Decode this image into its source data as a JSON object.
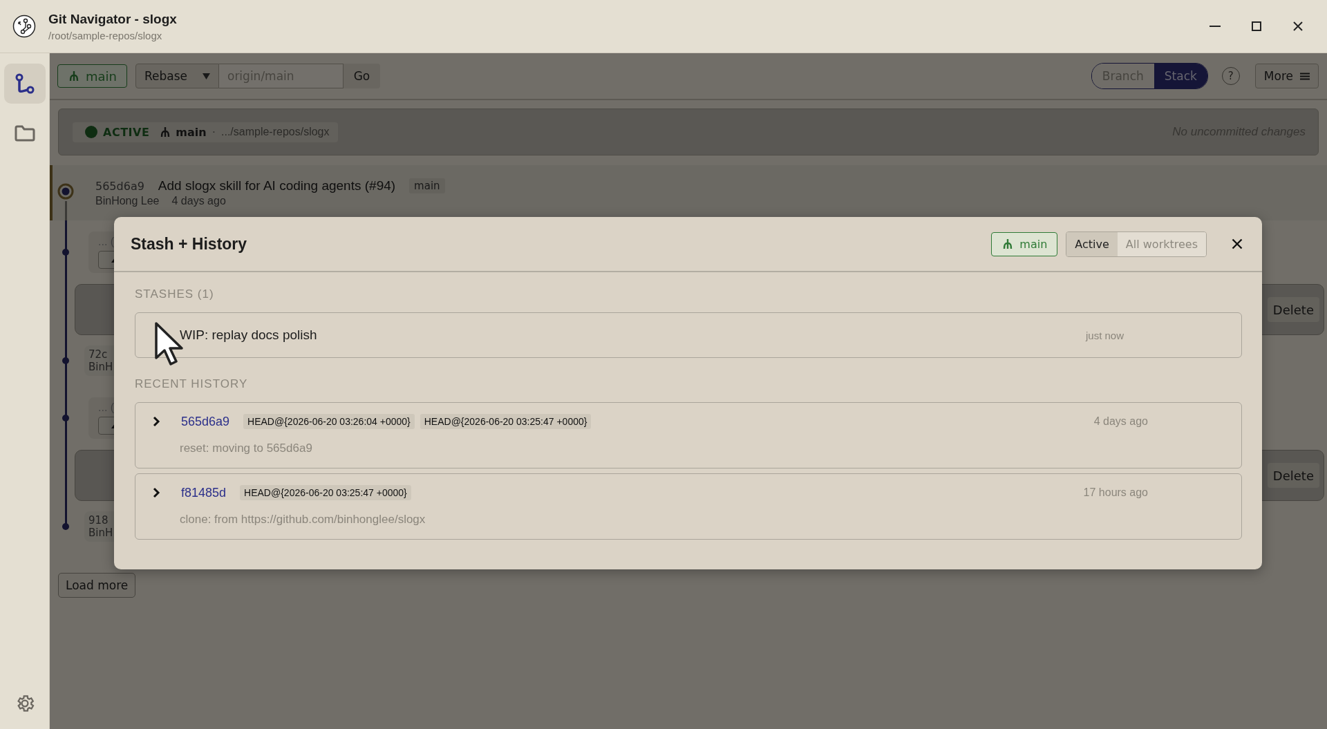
{
  "window": {
    "title": "Git Navigator - slogx",
    "path": "/root/sample-repos/slogx"
  },
  "sidebar": {
    "items": [
      {
        "kind": "graph",
        "selected": true
      },
      {
        "kind": "folder",
        "selected": false
      }
    ]
  },
  "toolbar": {
    "branch": "main",
    "mode": "Rebase",
    "target_placeholder": "origin/main",
    "go": "Go",
    "view_toggle": [
      {
        "label": "Branch",
        "selected": false
      },
      {
        "label": "Stack",
        "selected": true
      }
    ],
    "help": "?",
    "more": "More"
  },
  "worktree": {
    "status": "ACTIVE",
    "branch": "main",
    "separator": "·",
    "path": ".../sample-repos/slogx",
    "changes": "No uncommitted changes"
  },
  "timeline": [
    {
      "kind": "head",
      "hash": "565d6a9",
      "title": "Add slogx skill for AI coding agents (#94)",
      "tag": "main",
      "author": "BinHong Lee",
      "time": "4 days ago"
    },
    {
      "kind": "gap",
      "text": "... ("
    },
    {
      "kind": "card",
      "action": "Delete"
    },
    {
      "kind": "commit",
      "hash": "72c",
      "author": "BinH"
    },
    {
      "kind": "gap",
      "text": "... ("
    },
    {
      "kind": "card",
      "action": "Delete"
    },
    {
      "kind": "commit",
      "hash": "918",
      "author": "BinH"
    }
  ],
  "load_more": "Load more",
  "modal": {
    "title": "Stash + History",
    "branch": "main",
    "scopes": [
      {
        "label": "Active",
        "selected": true
      },
      {
        "label": "All worktrees",
        "selected": false
      }
    ],
    "stashes_heading": "STASHES (1)",
    "stashes": [
      {
        "message": "WIP: replay docs polish",
        "time": "just now"
      }
    ],
    "history_heading": "RECENT HISTORY",
    "history": [
      {
        "hash": "565d6a9",
        "refs": [
          "HEAD@{2026-06-20 03:26:04 +0000}",
          "HEAD@{2026-06-20 03:25:47 +0000}"
        ],
        "time": "4 days ago",
        "message": "reset: moving to 565d6a9"
      },
      {
        "hash": "f81485d",
        "refs": [
          "HEAD@{2026-06-20 03:25:47 +0000}"
        ],
        "time": "17 hours ago",
        "message": "clone: from https://github.com/binhonglee/slogx"
      }
    ]
  }
}
